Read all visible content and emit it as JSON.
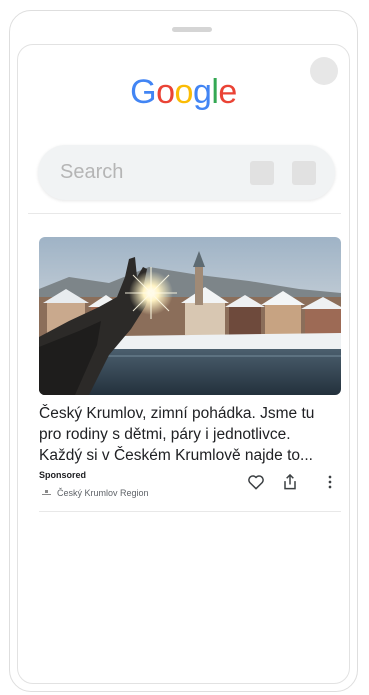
{
  "search": {
    "placeholder": "Search"
  },
  "logo": {
    "letters": [
      "G",
      "o",
      "o",
      "g",
      "l",
      "e"
    ],
    "colors": [
      "#4285F4",
      "#EA4335",
      "#FBBC05",
      "#4285F4",
      "#34A853",
      "#EA4335"
    ]
  },
  "ad": {
    "text_lines": [
      "Český Krumlov, zimní pohádka. Jsme tu",
      "pro rodiny s dětmi, páry i jednotlivce.",
      "Každý si v Českém Krumlově najde to..."
    ],
    "sponsored_label": "Sponsored",
    "advertiser": "Český Krumlov Region"
  },
  "icons": {
    "like": "heart-outline-icon",
    "share": "share-icon",
    "more": "more-vert-icon"
  },
  "colors": {
    "text": "#202124",
    "muted": "#5f6368",
    "search_bg": "#f1f3f4"
  }
}
